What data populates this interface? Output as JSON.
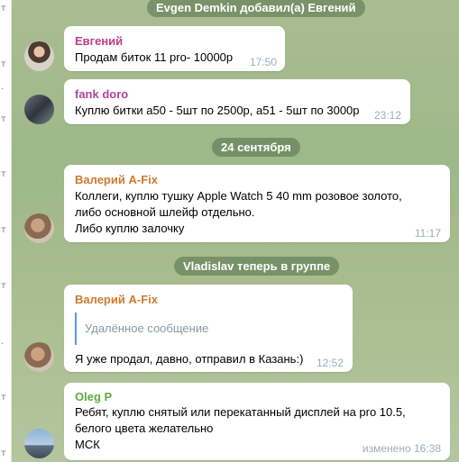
{
  "left_glyphs": [
    "т",
    ".",
    "т",
    "т",
    "т",
    "т",
    "т",
    ".",
    "т",
    "т",
    "т",
    "т",
    "т"
  ],
  "events": {
    "added": "Evgen Demkin добавил(а) Евгений",
    "date": "24 сентября",
    "joined": "Vladislav теперь в группе"
  },
  "messages": [
    {
      "sender": "Евгений",
      "sender_color": "#c03d86",
      "lines": [
        "Продам биток 11 pro- 10000р"
      ],
      "time": "17:50"
    },
    {
      "sender": "fank doro",
      "sender_color": "#b1449a",
      "lines": [
        "Куплю битки а50 - 5шт по 2500р, а51 - 5шт по 3000р"
      ],
      "time": "23:12"
    },
    {
      "sender": "Валерий A-Fix",
      "sender_color": "#d07a30",
      "lines": [
        "Коллеги, куплю тушку Apple Watch 5 40 mm розовое золото,",
        "либо основной шлейф отдельно.",
        "Либо куплю залочку"
      ],
      "time": "11:17"
    },
    {
      "sender": "Валерий A-Fix",
      "sender_color": "#d07a30",
      "reply": "Удалённое сообщение",
      "lines": [
        "Я уже продал, давно, отправил в Казань:)"
      ],
      "time": "12:52"
    },
    {
      "sender": "Oleg P",
      "sender_color": "#5eab3e",
      "lines": [
        "Ребят, куплю снятый или перекатанный дисплей на pro 10.5,",
        "белого цвета желательно",
        "МСК"
      ],
      "time": "изменено 16:38"
    }
  ]
}
